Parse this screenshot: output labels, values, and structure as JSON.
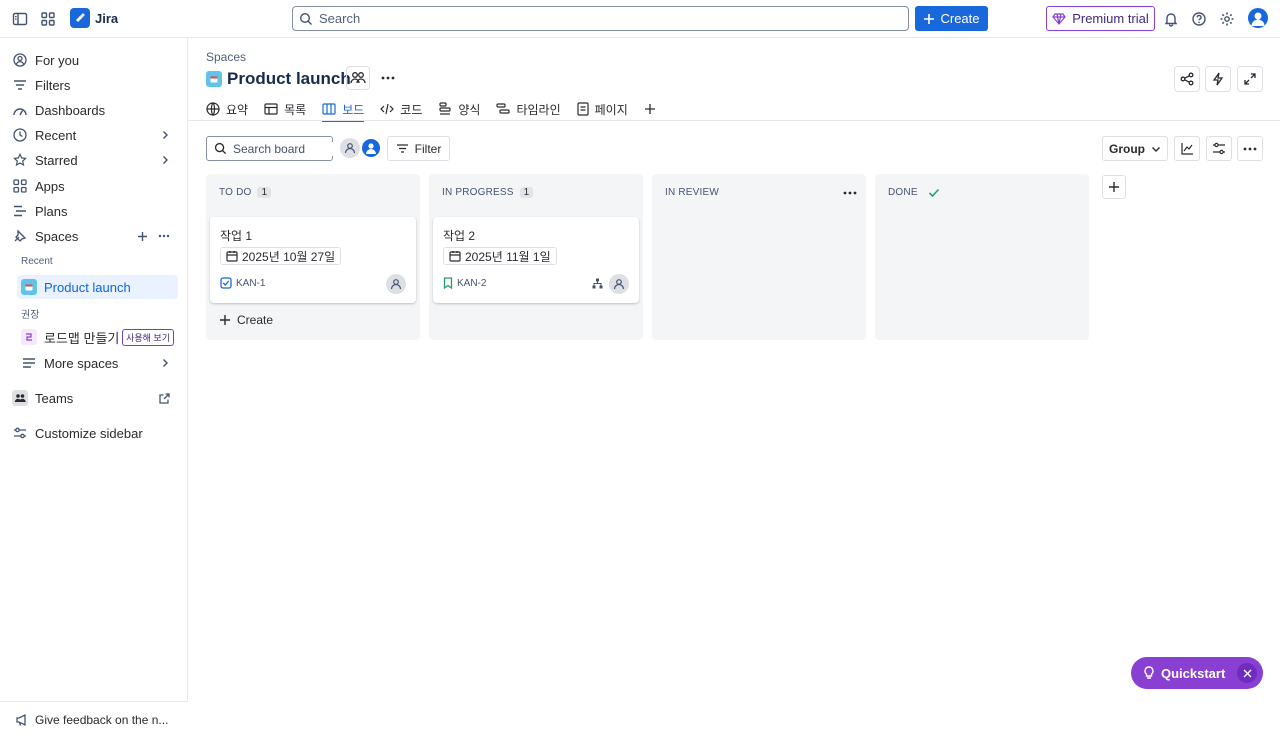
{
  "topbar": {
    "app_name": "Jira",
    "search_placeholder": "Search",
    "create_label": "Create",
    "premium_label": "Premium trial"
  },
  "sidebar": {
    "for_you": "For you",
    "filters": "Filters",
    "dashboards": "Dashboards",
    "recent": "Recent",
    "starred": "Starred",
    "apps": "Apps",
    "plans": "Plans",
    "spaces": "Spaces",
    "group_recent": "Recent",
    "product_launch": "Product launch",
    "group_recommended": "권장",
    "roadmap": "로드맵 만들기",
    "roadmap_badge": "사용해 보기",
    "more_spaces": "More spaces",
    "teams": "Teams",
    "customize": "Customize sidebar",
    "feedback": "Give feedback on the n..."
  },
  "header": {
    "breadcrumb": "Spaces",
    "title": "Product launch"
  },
  "tabs": [
    {
      "label": "요약"
    },
    {
      "label": "목록"
    },
    {
      "label": "보드"
    },
    {
      "label": "코드"
    },
    {
      "label": "양식"
    },
    {
      "label": "타임라인"
    },
    {
      "label": "페이지"
    }
  ],
  "toolbar": {
    "search_placeholder": "Search board",
    "filter_label": "Filter",
    "group_label": "Group"
  },
  "columns": [
    {
      "title": "TO DO",
      "count": "1",
      "card": {
        "title": "작업 1",
        "date": "2025년 10월 27일",
        "key": "KAN-1"
      },
      "create_label": "Create"
    },
    {
      "title": "IN PROGRESS",
      "count": "1",
      "card": {
        "title": "작업 2",
        "date": "2025년 11월 1일",
        "key": "KAN-2"
      }
    },
    {
      "title": "IN REVIEW"
    },
    {
      "title": "DONE"
    }
  ],
  "quickstart": {
    "label": "Quickstart"
  },
  "colors": {
    "brand": "#1868db",
    "premium": "#8a3fd3",
    "done_check": "#22a06b"
  }
}
